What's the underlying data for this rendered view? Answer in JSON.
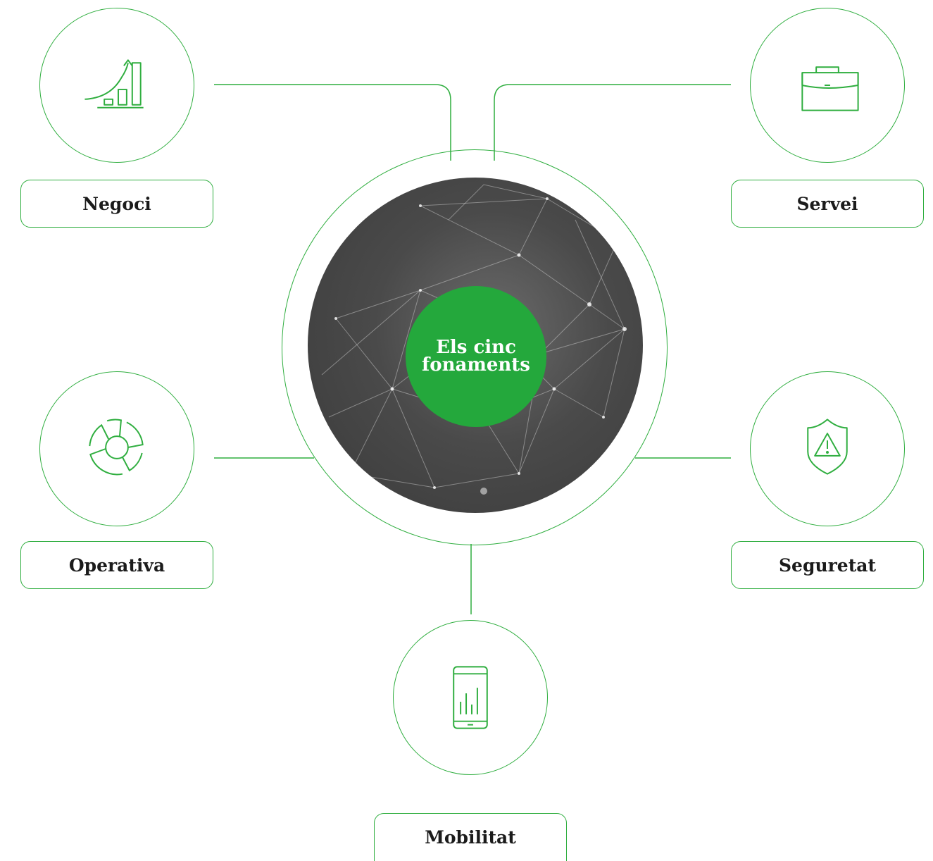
{
  "center": {
    "line1": "Els cinc",
    "line2": "fonaments"
  },
  "nodes": [
    {
      "id": "negoci",
      "label": "Negoci",
      "icon": "growth-chart-icon"
    },
    {
      "id": "servei",
      "label": "Servei",
      "icon": "briefcase-icon"
    },
    {
      "id": "operativa",
      "label": "Operativa",
      "icon": "donut-chart-icon"
    },
    {
      "id": "seguretat",
      "label": "Seguretat",
      "icon": "shield-warning-icon"
    },
    {
      "id": "mobilitat",
      "label": "Mobilitat",
      "icon": "mobile-chart-icon"
    }
  ],
  "colors": {
    "accent": "#2fae3f",
    "badge": "#24a83c",
    "label_text": "#1b1b1b"
  }
}
